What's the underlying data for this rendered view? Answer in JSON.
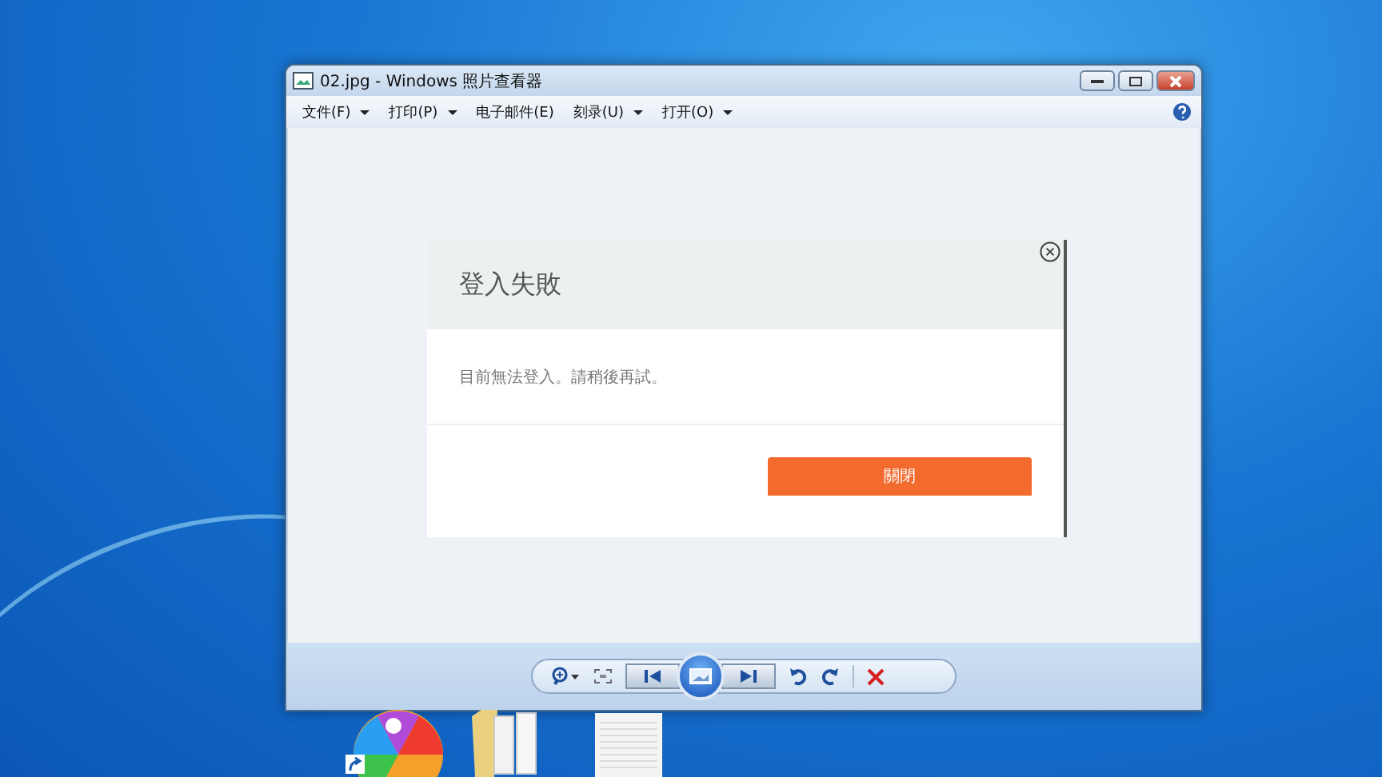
{
  "window": {
    "title": "02.jpg - Windows 照片查看器"
  },
  "menu": [
    {
      "label": "文件(F)",
      "kind": "dropdown"
    },
    {
      "label": "打印(P)",
      "kind": "dropdown"
    },
    {
      "label": "电子邮件(E)",
      "kind": "plain"
    },
    {
      "label": "刻录(U)",
      "kind": "dropdown"
    },
    {
      "label": "打开(O)",
      "kind": "dropdown"
    }
  ],
  "photo": {
    "dialog": {
      "title": "登入失敗",
      "message": "目前無法登入。請稍後再試。",
      "button": "關閉"
    }
  }
}
